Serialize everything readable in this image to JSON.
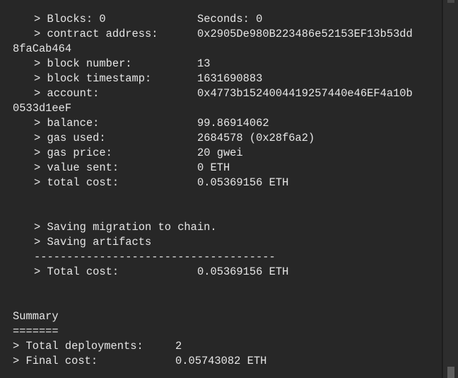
{
  "terminal": {
    "lines_top": [
      {
        "label": "> Blocks: 0",
        "value": "Seconds: 0"
      },
      {
        "label": "> contract address:",
        "value": "0x2905De980B223486e52153EF13b53dd"
      },
      {
        "wrap": "8faCab464"
      },
      {
        "label": "> block number:",
        "value": "13"
      },
      {
        "label": "> block timestamp:",
        "value": "1631690883"
      },
      {
        "label": "> account:",
        "value": "0x4773b1524004419257440e46EF4a10b"
      },
      {
        "wrap": "0533d1eeF"
      },
      {
        "label": "> balance:",
        "value": "99.86914062"
      },
      {
        "label": "> gas used:",
        "value": "2684578 (0x28f6a2)"
      },
      {
        "label": "> gas price:",
        "value": "20 gwei"
      },
      {
        "label": "> value sent:",
        "value": "0 ETH"
      },
      {
        "label": "> total cost:",
        "value": "0.05369156 ETH"
      }
    ],
    "saving_migration": "> Saving migration to chain.",
    "saving_artifacts": "> Saving artifacts",
    "separator": "-------------------------------------",
    "total_cost_label": "> Total cost:",
    "total_cost_value": "0.05369156 ETH",
    "summary_title": "Summary",
    "summary_underline": "=======",
    "total_deployments_label": "> Total deployments:",
    "total_deployments_value": "2",
    "final_cost_label": "> Final cost:",
    "final_cost_value": "0.05743082 ETH"
  }
}
